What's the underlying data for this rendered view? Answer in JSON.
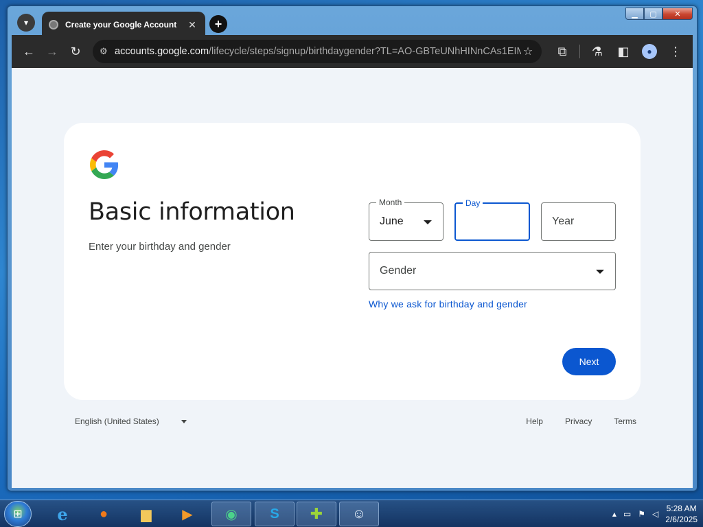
{
  "browser": {
    "tab_title": "Create your Google Account",
    "url_host": "accounts.google.com",
    "url_path": "/lifecycle/steps/signup/birthdaygender?TL=AO-GBTeUNhHINnCAs1EIM..."
  },
  "icons": {
    "tab_search": "▾",
    "tab_close": "✕",
    "new_tab": "+",
    "back": "←",
    "forward": "→",
    "reload": "↻",
    "site_info": "⚙",
    "star": "☆",
    "extensions": "⧉",
    "labs": "⚗",
    "side_panel": "◧",
    "avatar": "●",
    "menu": "⋮",
    "minimize": "▁",
    "maximize": "▢",
    "close": "✕",
    "start": "⊞"
  },
  "page": {
    "heading": "Basic information",
    "subheading": "Enter your birthday and gender",
    "month": {
      "label": "Month",
      "value": "June"
    },
    "day": {
      "label": "Day",
      "value": ""
    },
    "year": {
      "placeholder": "Year"
    },
    "gender": {
      "placeholder": "Gender"
    },
    "why_link": "Why we ask for birthday and gender",
    "next_button": "Next"
  },
  "footer": {
    "language": "English (United States)",
    "help": "Help",
    "privacy": "Privacy",
    "terms": "Terms"
  },
  "taskbar": {
    "time": "5:28 AM",
    "date": "2/6/2025"
  },
  "colors": {
    "primary": "#0b57d0",
    "page_bg": "#f0f4f9",
    "card_bg": "#ffffff"
  }
}
